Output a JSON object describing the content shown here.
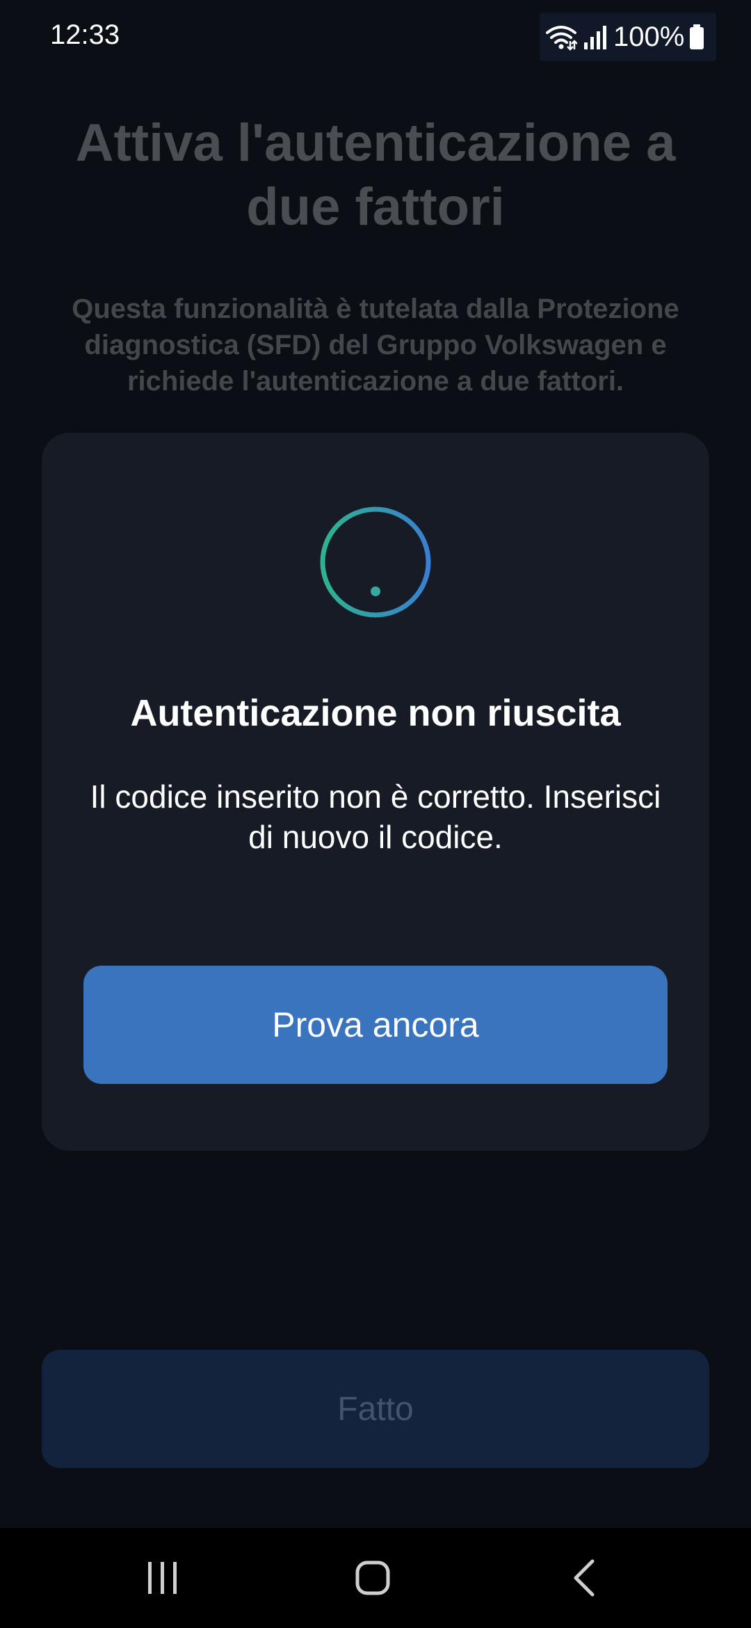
{
  "status_bar": {
    "time": "12:33",
    "battery": "100%",
    "icons": [
      "wifi-icon",
      "signal-icon",
      "battery-icon"
    ]
  },
  "page": {
    "title": "Attiva l'autenticazione a due fattori",
    "description": "Questa funzionalità è tutelata dalla Protezione diagnostica (SFD) del Gruppo Volkswagen e richiede l'autenticazione a due fattori.",
    "done_label": "Fatto"
  },
  "dialog": {
    "icon": "warning-icon",
    "title": "Autenticazione non riuscita",
    "message": "Il codice inserito non è corretto. Inserisci di nuovo il codice.",
    "retry_label": "Prova ancora"
  },
  "nav_bar": {
    "icons": [
      "recents-icon",
      "home-icon",
      "back-icon"
    ]
  },
  "colors": {
    "background": "#0b0e14",
    "dialog": "#171b25",
    "primary_button": "#3a74be",
    "icon_gradient_start": "#2fb38e",
    "icon_gradient_end": "#3a7fd1"
  }
}
